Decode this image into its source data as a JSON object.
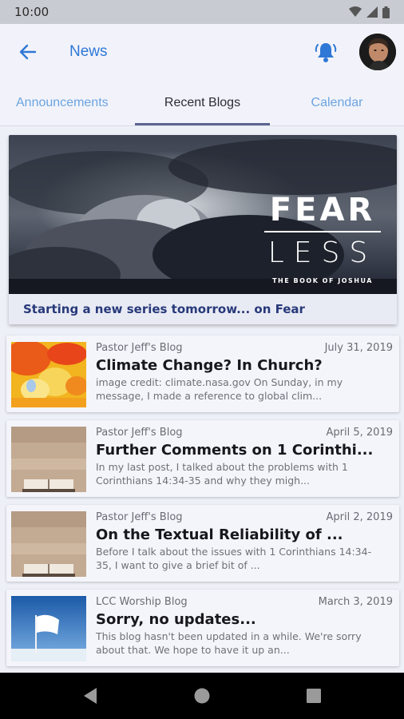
{
  "status": {
    "time": "10:00"
  },
  "appbar": {
    "title": "News"
  },
  "tabs": [
    {
      "label": "Announcements"
    },
    {
      "label": "Recent Blogs"
    },
    {
      "label": "Calendar"
    }
  ],
  "hero": {
    "word1": "FEAR",
    "word2": "LESS",
    "subtitle": "THE BOOK OF JOSHUA",
    "caption": "Starting a new series tomorrow... on Fear"
  },
  "posts": [
    {
      "source": "Pastor Jeff's Blog",
      "date": "July 31, 2019",
      "title": "Climate Change? In Church?",
      "excerpt": "image credit: climate.nasa.gov On Sunday, in my message, I made a reference to global clim..."
    },
    {
      "source": "Pastor Jeff's Blog",
      "date": "April 5, 2019",
      "title": "Further Comments on 1 Corinthi...",
      "excerpt": "In my last post, I talked about the problems with 1 Corinthians 14:34-35 and why they migh..."
    },
    {
      "source": "Pastor Jeff's Blog",
      "date": "April 2, 2019",
      "title": "On the Textual Reliability of ...",
      "excerpt": "Before I talk about the issues with 1 Corinthians 14:34-35, I want to give a brief bit of ..."
    },
    {
      "source": "LCC Worship Blog",
      "date": "March 3, 2019",
      "title": "Sorry, no updates...",
      "excerpt": "This blog hasn't been updated in a while. We're sorry about that. We hope to have it up an..."
    }
  ],
  "colors": {
    "accent": "#2f78d6",
    "tab_inactive": "#6ba4e0",
    "caption": "#27397a"
  }
}
